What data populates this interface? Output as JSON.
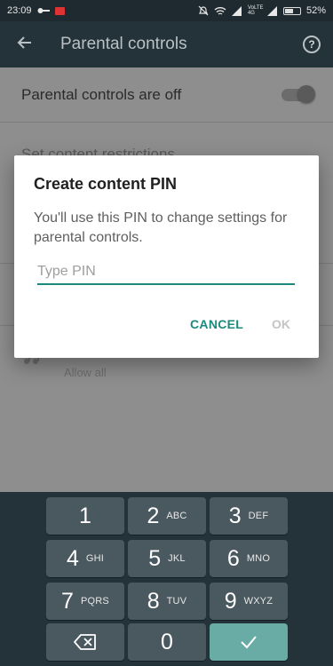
{
  "status_bar": {
    "time": "23:09",
    "network": "VoLTE 4G",
    "battery": "52%"
  },
  "toolbar": {
    "title": "Parental controls",
    "back_icon": "arrow-back-icon",
    "help_icon": "help-circle-icon"
  },
  "background": {
    "parental_off_label": "Parental controls are off",
    "content_restrictions_label": "Set content restrictions",
    "allow_all_label": "Allow all"
  },
  "dialog": {
    "title": "Create content PIN",
    "message": "You'll use this PIN to change settings for parental controls.",
    "pin_placeholder": "Type PIN",
    "pin_value": "",
    "cancel_label": "CANCEL",
    "ok_label": "OK"
  },
  "keypad": {
    "keys": [
      {
        "num": "1",
        "letters": ""
      },
      {
        "num": "2",
        "letters": "ABC"
      },
      {
        "num": "3",
        "letters": "DEF"
      },
      {
        "num": "4",
        "letters": "GHI"
      },
      {
        "num": "5",
        "letters": "JKL"
      },
      {
        "num": "6",
        "letters": "MNO"
      },
      {
        "num": "7",
        "letters": "PQRS"
      },
      {
        "num": "8",
        "letters": "TUV"
      },
      {
        "num": "9",
        "letters": "WXYZ"
      },
      {
        "num": "0",
        "letters": ""
      }
    ],
    "delete_icon": "backspace-icon",
    "done_icon": "check-icon"
  },
  "colors": {
    "accent": "#1b8a7c",
    "toolbar": "#243239",
    "keypad_key": "#4a585f",
    "done_key": "#68aca5"
  }
}
